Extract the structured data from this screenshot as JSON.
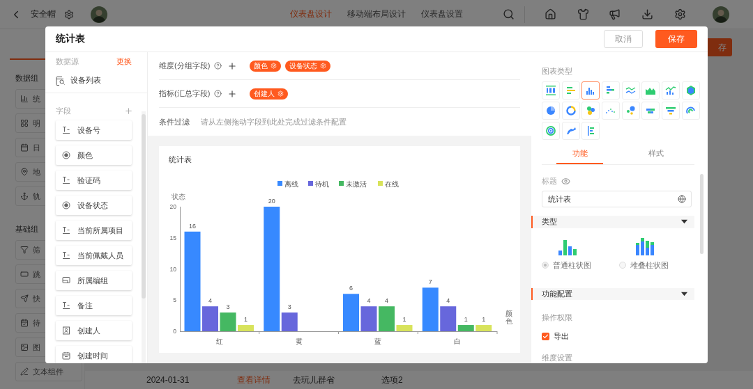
{
  "topbar": {
    "app_title": "安全帽",
    "tabs": [
      {
        "label": "仪表盘设计",
        "selected": true
      },
      {
        "label": "移动端布局设计",
        "selected": false
      },
      {
        "label": "仪表盘设置",
        "selected": false
      }
    ]
  },
  "sidebar": {
    "sections": [
      {
        "title": "数据组",
        "items": [
          {
            "label": "统",
            "kind": "bar"
          },
          {
            "label": "明",
            "kind": "grid"
          },
          {
            "label": "日",
            "kind": "calendar"
          },
          {
            "label": "地",
            "kind": "pin"
          },
          {
            "label": "轨",
            "kind": "route"
          }
        ]
      },
      {
        "title": "基础组",
        "items": [
          {
            "label": "筛",
            "kind": "filter"
          },
          {
            "label": "跳",
            "kind": "link"
          },
          {
            "label": "快",
            "kind": "send"
          },
          {
            "label": "待",
            "kind": "todo"
          },
          {
            "label": "图",
            "kind": "image"
          },
          {
            "label": "文本组件",
            "kind": "pen"
          }
        ]
      }
    ]
  },
  "background": {
    "save_button": "存",
    "table_row": [
      {
        "label": "2024-01-31",
        "kind": "text"
      },
      {
        "label": "查看详情",
        "kind": "link"
      },
      {
        "label": "去玩儿群省",
        "kind": "text"
      },
      {
        "label": "选项2",
        "kind": "text"
      }
    ]
  },
  "modal": {
    "title": "统计表",
    "cancel": "取消",
    "save": "保存",
    "data_source": {
      "label": "数据源",
      "change": "更换",
      "name": "设备列表"
    },
    "fields": {
      "label": "字段",
      "items": [
        {
          "label": "设备号",
          "kind": "text"
        },
        {
          "label": "颜色",
          "kind": "radio"
        },
        {
          "label": "验证码",
          "kind": "text"
        },
        {
          "label": "设备状态",
          "kind": "radio"
        },
        {
          "label": "当前所属项目",
          "kind": "text"
        },
        {
          "label": "当前佩戴人员",
          "kind": "text"
        },
        {
          "label": "所属编组",
          "kind": "group"
        },
        {
          "label": "备注",
          "kind": "text"
        },
        {
          "label": "创建人",
          "kind": "person"
        },
        {
          "label": "创建时间",
          "kind": "date"
        }
      ]
    },
    "config_rows": [
      {
        "label": "维度(分组字段)",
        "kind": "tags",
        "tags": [
          "颜色",
          "设备状态"
        ]
      },
      {
        "label": "指标(汇总字段)",
        "kind": "tags",
        "tags": [
          "创建人"
        ]
      },
      {
        "label": "条件过滤",
        "kind": "hint",
        "hint": "请从左侧拖动字段到此处完成过滤条件配置"
      }
    ],
    "chart_data": {
      "type": "bar",
      "title": "统计表",
      "xlabel": "颜色",
      "ylabel": "状态",
      "categories": [
        "红",
        "黄",
        "蓝",
        "白"
      ],
      "series": [
        {
          "name": "离线",
          "color": "#3789ff",
          "values": [
            16,
            20,
            6,
            7
          ]
        },
        {
          "name": "待机",
          "color": "#6767dc",
          "values": [
            4,
            3,
            4,
            4
          ]
        },
        {
          "name": "未激活",
          "color": "#45b862",
          "values": [
            3,
            null,
            4,
            1
          ]
        },
        {
          "name": "在线",
          "color": "#d8e35b",
          "values": [
            1,
            null,
            1,
            1
          ]
        }
      ],
      "legend": "top",
      "ylim": [
        0,
        20
      ],
      "yticks": [
        0,
        5,
        10,
        15,
        20
      ],
      "data_labels": true
    },
    "right_panel": {
      "chart_type_label": "图表类型",
      "chart_types": [
        {
          "kind": "number",
          "selected": false
        },
        {
          "kind": "hbar",
          "selected": false
        },
        {
          "kind": "bar",
          "selected": true
        },
        {
          "kind": "hbar-stack",
          "selected": false
        },
        {
          "kind": "line",
          "selected": false
        },
        {
          "kind": "area",
          "selected": false
        },
        {
          "kind": "combo",
          "selected": false
        },
        {
          "kind": "radar",
          "selected": false
        },
        {
          "kind": "pie",
          "selected": false
        },
        {
          "kind": "donut",
          "selected": false
        },
        {
          "kind": "rose",
          "selected": false
        },
        {
          "kind": "scatter",
          "selected": false
        },
        {
          "kind": "bubble",
          "selected": false
        },
        {
          "kind": "butterfly",
          "selected": false
        },
        {
          "kind": "funnel",
          "selected": false
        },
        {
          "kind": "gauge",
          "selected": false
        },
        {
          "kind": "ring",
          "selected": false
        },
        {
          "kind": "map",
          "selected": false
        },
        {
          "kind": "gantt",
          "selected": false
        }
      ],
      "tabs": [
        {
          "label": "功能",
          "selected": true
        },
        {
          "label": "样式",
          "selected": false
        }
      ],
      "title_label": "标题",
      "title_value": "统计表",
      "type_section": {
        "title": "类型",
        "expanded": true,
        "options": [
          {
            "label": "普通柱状图",
            "kind": "plain",
            "selected": true
          },
          {
            "label": "堆叠柱状图",
            "kind": "stacked",
            "selected": false
          }
        ]
      },
      "function_section": {
        "title": "功能配置",
        "expanded": true,
        "permission_label": "操作权限",
        "export": {
          "label": "导出",
          "checked": true
        },
        "dimension_label": "维度设置"
      }
    }
  }
}
